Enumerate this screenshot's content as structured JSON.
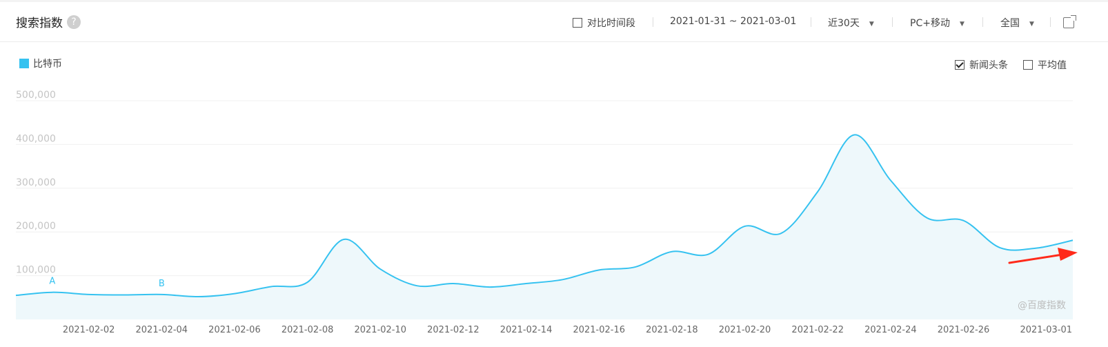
{
  "header": {
    "title": "搜索指数",
    "help_label": "?",
    "compare_label": "对比时间段",
    "date_range": "2021-01-31 ~ 2021-03-01",
    "period": "近30天",
    "device": "PC+移动",
    "region": "全国"
  },
  "options": {
    "news_label": "新闻头条",
    "news_checked": true,
    "average_label": "平均值",
    "average_checked": false
  },
  "watermark": "@百度指数",
  "colors": {
    "series": "#35c2f0",
    "fill": "#eef8fb",
    "accent": "#3a7bd5",
    "arrow": "#ff2a1a"
  },
  "chart_data": {
    "type": "area",
    "x": [
      "2021-01-31",
      "2021-02-01",
      "2021-02-02",
      "2021-02-03",
      "2021-02-04",
      "2021-02-05",
      "2021-02-06",
      "2021-02-07",
      "2021-02-08",
      "2021-02-09",
      "2021-02-10",
      "2021-02-11",
      "2021-02-12",
      "2021-02-13",
      "2021-02-14",
      "2021-02-15",
      "2021-02-16",
      "2021-02-17",
      "2021-02-18",
      "2021-02-19",
      "2021-02-20",
      "2021-02-21",
      "2021-02-22",
      "2021-02-23",
      "2021-02-24",
      "2021-02-25",
      "2021-02-26",
      "2021-02-27",
      "2021-02-28",
      "2021-03-01"
    ],
    "xticks": [
      "2021-02-02",
      "2021-02-04",
      "2021-02-06",
      "2021-02-08",
      "2021-02-10",
      "2021-02-12",
      "2021-02-14",
      "2021-02-16",
      "2021-02-18",
      "2021-02-20",
      "2021-02-22",
      "2021-02-24",
      "2021-02-26",
      "2021-03-01"
    ],
    "series": [
      {
        "name": "比特币",
        "values": [
          55000,
          62000,
          57000,
          56000,
          57000,
          52000,
          59000,
          75000,
          85000,
          183000,
          115000,
          77000,
          82000,
          74000,
          82000,
          91000,
          113000,
          120000,
          155000,
          149000,
          213000,
          197000,
          292000,
          422000,
          318000,
          232000,
          226000,
          164000,
          163000,
          181000
        ]
      }
    ],
    "ylim": [
      0,
      500000
    ],
    "yticks": [
      100000,
      200000,
      300000,
      400000,
      500000
    ],
    "ytick_labels": [
      "100,000",
      "200,000",
      "300,000",
      "400,000",
      "500,000"
    ],
    "grid": true,
    "legend_position": "top-left",
    "annotations": [
      {
        "text": "A",
        "x": "2021-02-01",
        "y": 62000
      },
      {
        "text": "B",
        "x": "2021-02-04",
        "y": 57000
      }
    ]
  }
}
